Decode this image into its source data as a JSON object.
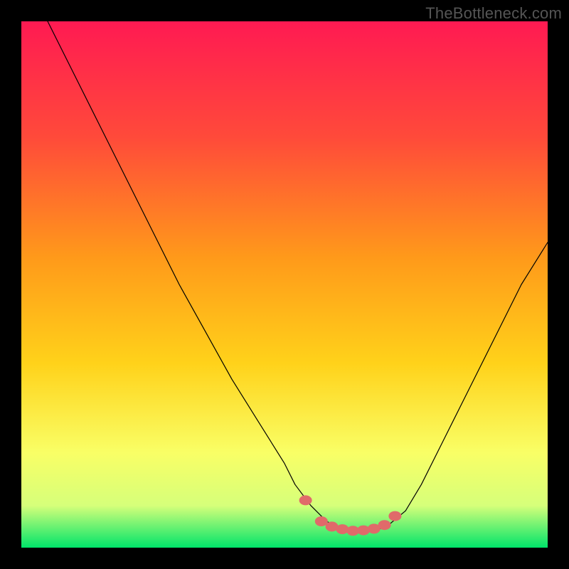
{
  "watermark": "TheBottleneck.com",
  "chart_data": {
    "type": "line",
    "title": "",
    "xlabel": "",
    "ylabel": "",
    "xlim": [
      0,
      100
    ],
    "ylim": [
      0,
      100
    ],
    "grid": false,
    "legend": false,
    "background_gradient": {
      "top": "#ff1a52",
      "upper_mid": "#ff6a2a",
      "mid": "#ffd21a",
      "lower_mid": "#f9ff66",
      "near_bottom": "#d6ff7a",
      "bottom": "#00e46a"
    },
    "series": [
      {
        "name": "curve",
        "stroke": "#000000",
        "stroke_width": 1.2,
        "x": [
          5,
          10,
          15,
          20,
          25,
          30,
          35,
          40,
          45,
          50,
          52,
          55,
          58,
          60,
          62,
          65,
          68,
          70,
          73,
          76,
          80,
          85,
          90,
          95,
          100
        ],
        "y": [
          100,
          90,
          80,
          70,
          60,
          50,
          41,
          32,
          24,
          16,
          12,
          8,
          5,
          4,
          3.5,
          3.2,
          3.5,
          4.5,
          7,
          12,
          20,
          30,
          40,
          50,
          58
        ]
      },
      {
        "name": "minimum-markers",
        "marker_color": "#e06a6a",
        "x": [
          54,
          57,
          59,
          61,
          63,
          65,
          67,
          69,
          71
        ],
        "y": [
          9,
          5,
          4,
          3.5,
          3.2,
          3.3,
          3.6,
          4.3,
          6
        ]
      }
    ],
    "annotations": []
  }
}
